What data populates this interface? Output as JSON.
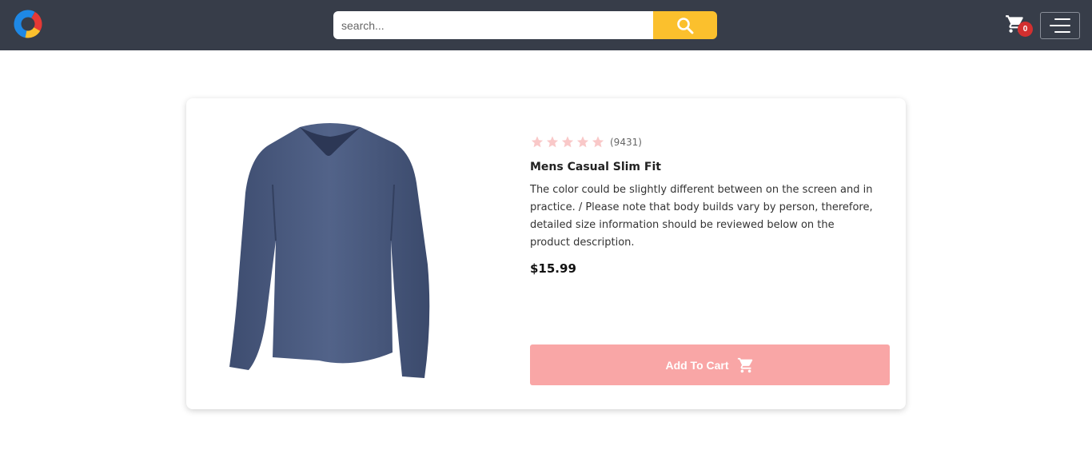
{
  "header": {
    "logo_icon": "donut-logo-icon",
    "search": {
      "placeholder": "search...",
      "value": "",
      "button_icon": "search-icon"
    },
    "cart": {
      "icon": "cart-icon",
      "count": "0"
    },
    "menu_icon": "hamburger-menu-icon"
  },
  "product": {
    "image_icon": "long-sleeve-shirt-image",
    "rating": {
      "stars": 5,
      "count_text": "(9431)"
    },
    "title": "Mens Casual Slim Fit",
    "description": "The color could be slightly different between on the screen and in practice. / Please note that body builds vary by person, therefore, detailed size information should be reviewed below on the product description.",
    "price": "$15.99",
    "add_to_cart_label": "Add To Cart",
    "add_to_cart_icon": "cart-icon"
  },
  "colors": {
    "topbar": "#373d49",
    "search_button": "#fbc02d",
    "badge": "#d32f2f",
    "star": "#f9c8c8",
    "add_button": "#f9a6a6",
    "shirt": "#4a5a7e"
  }
}
